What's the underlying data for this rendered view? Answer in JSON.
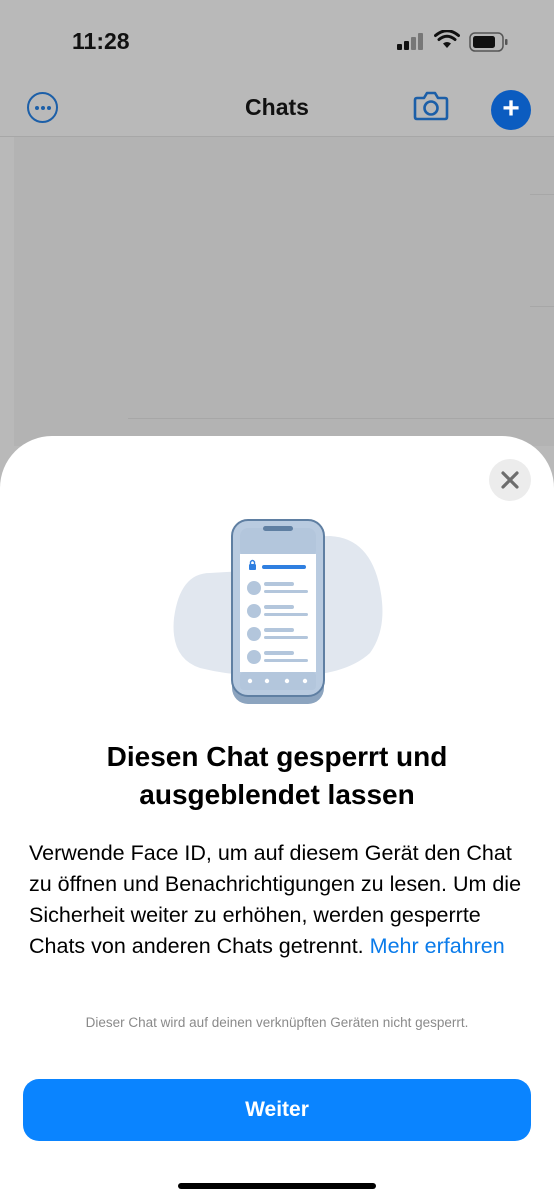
{
  "status_bar": {
    "time": "11:28"
  },
  "nav": {
    "title": "Chats"
  },
  "sheet": {
    "title": "Diesen Chat gesperrt und ausgeblendet lassen",
    "body": "Verwende Face ID, um auf diesem Gerät den Chat zu öffnen und Benachrichtigungen zu lesen. Um die Sicherheit weiter zu erhöhen, werden gesperrte Chats von anderen Chats getrennt.",
    "link": "Mehr erfahren",
    "footnote": "Dieser Chat wird auf deinen verknüpften Geräten nicht gesperrt.",
    "button": "Weiter"
  },
  "icons": {
    "more": "ellipsis-circle-icon",
    "camera": "camera-icon",
    "new_chat": "plus-icon",
    "close": "close-icon",
    "illustration": "locked-chat-phone-illustration"
  },
  "colors": {
    "accent": "#0a84ff",
    "link": "#0a7bea",
    "nav_icon": "#1c5fa8"
  }
}
